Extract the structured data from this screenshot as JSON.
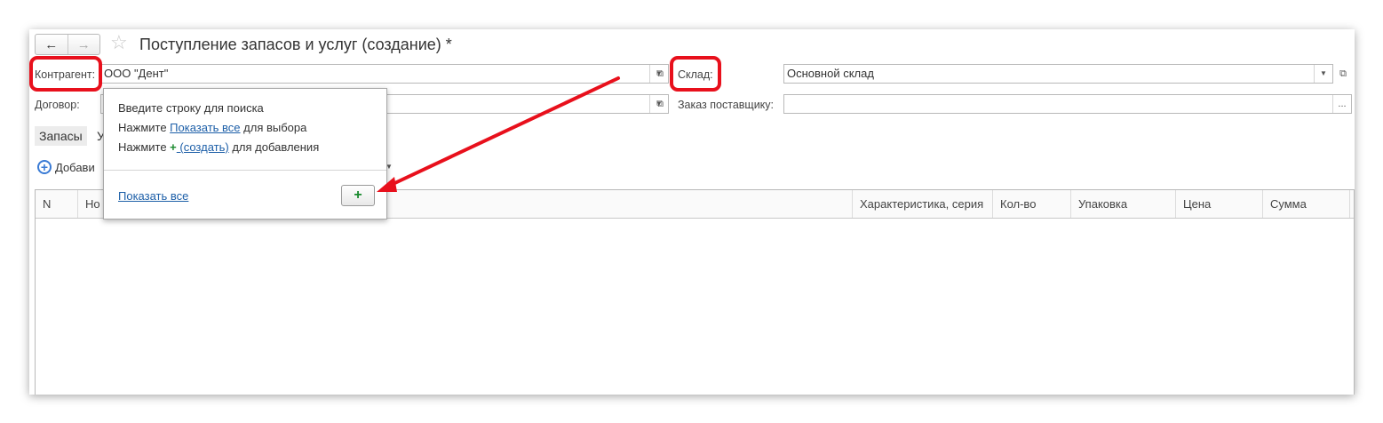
{
  "window": {
    "title": "Поступление запасов и услуг (создание) *",
    "nav_back": "←",
    "nav_forward": "→",
    "favorite_icon": "☆"
  },
  "form": {
    "counterparty_label": "Контрагент:",
    "counterparty_value": "ООО \"Дент\"",
    "warehouse_label": "Склад:",
    "warehouse_value": "Основной склад",
    "contract_label": "Договор:",
    "supplier_order_label": "Заказ поставщику:",
    "supplier_order_btn": "..."
  },
  "tabs": [
    {
      "label": "Запасы"
    },
    {
      "label": "У"
    }
  ],
  "toolbar": {
    "add_label": "Добави"
  },
  "table": {
    "columns": [
      "N",
      "Но",
      "Характеристика, серия",
      "Кол-во",
      "Упаковка",
      "Цена",
      "Сумма"
    ]
  },
  "popup": {
    "line1": "Введите строку для поиска",
    "line2_prefix": "Нажмите ",
    "line2_link": "Показать все",
    "line2_suffix": " для выбора",
    "line3_prefix": "Нажмите ",
    "line3_link": " (создать)",
    "line3_suffix": " для добавления",
    "show_all": "Показать все",
    "create_icon": "+"
  },
  "annotation_colors": {
    "highlight": "#e8101c"
  }
}
